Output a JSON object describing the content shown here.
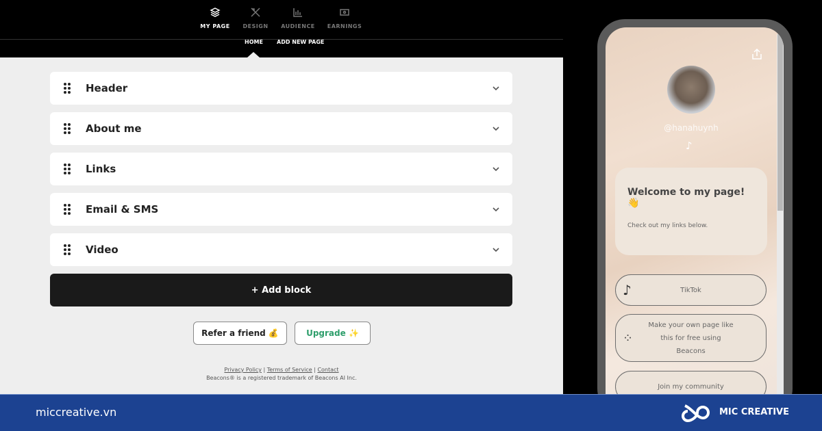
{
  "nav": {
    "tabs": [
      {
        "label": "MY PAGE",
        "icon": "layers-icon",
        "active": true
      },
      {
        "label": "DESIGN",
        "icon": "design-tools-icon"
      },
      {
        "label": "AUDIENCE",
        "icon": "bar-chart-icon"
      },
      {
        "label": "EARNINGS",
        "icon": "money-icon"
      }
    ],
    "subtabs": [
      {
        "label": "HOME",
        "active": true
      },
      {
        "label": "ADD NEW PAGE"
      }
    ]
  },
  "blocks": [
    {
      "label": "Header"
    },
    {
      "label": "About me"
    },
    {
      "label": "Links"
    },
    {
      "label": "Email & SMS"
    },
    {
      "label": "Video"
    }
  ],
  "add_block": "+ Add block",
  "refer": "Refer a friend 💰",
  "upgrade": "Upgrade ✨",
  "upgrade_color": "#2e9e6b",
  "footer_links": {
    "privacy": "Privacy Policy",
    "sep": " | ",
    "terms": "Terms of Service",
    "contact": "Contact",
    "trademark": "Beacons® is a registered trademark of Beacons AI Inc."
  },
  "preview": {
    "handle": "@hanahuynh",
    "welcome_title": "Welcome to my page! 👋",
    "welcome_text": "Check out my links below.",
    "links": [
      {
        "label": "TikTok",
        "icon": "tiktok-icon"
      },
      {
        "label": "Make your own page like this for free using Beacons",
        "icon": "beacons-icon"
      },
      {
        "label": "Join my community"
      }
    ]
  },
  "banner": {
    "site": "miccreative.vn",
    "brand": "MIC CREATIVE",
    "color": "#1c4291"
  }
}
